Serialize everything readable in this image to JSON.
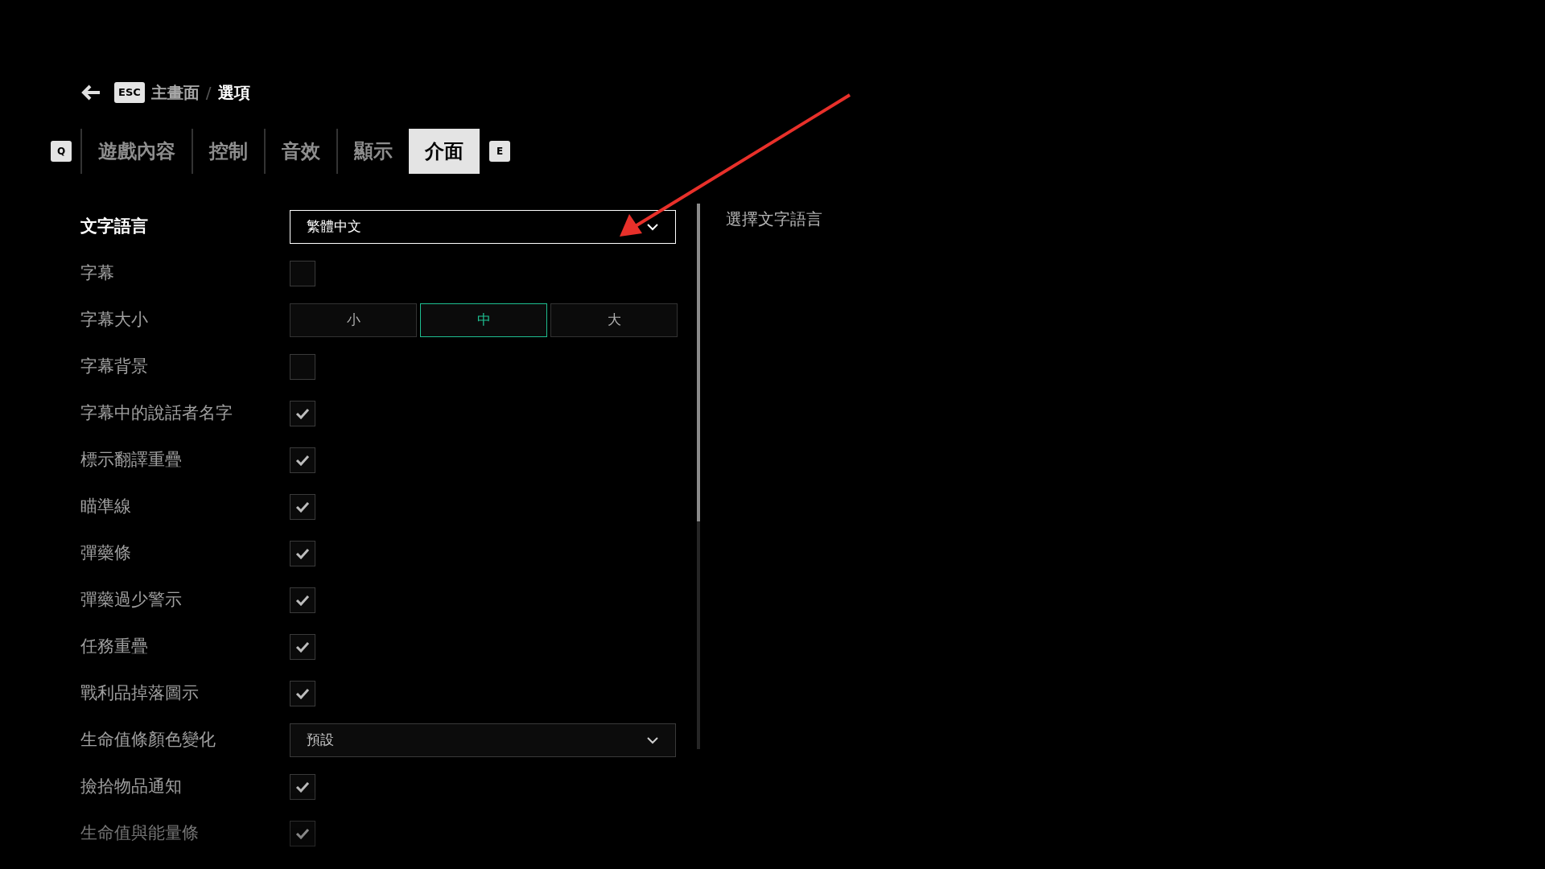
{
  "breadcrumb": {
    "key": "ESC",
    "parent": "主畫面",
    "separator": "/",
    "current": "選項"
  },
  "tabs": {
    "prev_key": "Q",
    "next_key": "E",
    "items": [
      {
        "label": "遊戲內容",
        "selected": false
      },
      {
        "label": "控制",
        "selected": false
      },
      {
        "label": "音效",
        "selected": false
      },
      {
        "label": "顯示",
        "selected": false
      },
      {
        "label": "介面",
        "selected": true
      }
    ]
  },
  "settings": [
    {
      "kind": "dropdown",
      "label": "文字語言",
      "value": "繁體中文",
      "selected": true
    },
    {
      "kind": "checkbox",
      "label": "字幕",
      "checked": false,
      "selected": false
    },
    {
      "kind": "segmented",
      "label": "字幕大小",
      "selected": false,
      "options": [
        {
          "label": "小",
          "selected": false
        },
        {
          "label": "中",
          "selected": true
        },
        {
          "label": "大",
          "selected": false
        }
      ]
    },
    {
      "kind": "checkbox",
      "label": "字幕背景",
      "checked": false,
      "selected": false
    },
    {
      "kind": "checkbox",
      "label": "字幕中的說話者名字",
      "checked": true,
      "selected": false
    },
    {
      "kind": "checkbox",
      "label": "標示翻譯重疊",
      "checked": true,
      "selected": false
    },
    {
      "kind": "checkbox",
      "label": "瞄準線",
      "checked": true,
      "selected": false
    },
    {
      "kind": "checkbox",
      "label": "彈藥條",
      "checked": true,
      "selected": false
    },
    {
      "kind": "checkbox",
      "label": "彈藥過少警示",
      "checked": true,
      "selected": false
    },
    {
      "kind": "checkbox",
      "label": "任務重疊",
      "checked": true,
      "selected": false
    },
    {
      "kind": "checkbox",
      "label": "戰利品掉落圖示",
      "checked": true,
      "selected": false
    },
    {
      "kind": "dropdown",
      "label": "生命值條顏色變化",
      "value": "預設",
      "selected": false
    },
    {
      "kind": "checkbox",
      "label": "撿拾物品通知",
      "checked": true,
      "selected": false
    },
    {
      "kind": "checkbox",
      "label": "生命值與能量條",
      "checked": true,
      "selected": false
    }
  ],
  "description": "選擇文字語言"
}
